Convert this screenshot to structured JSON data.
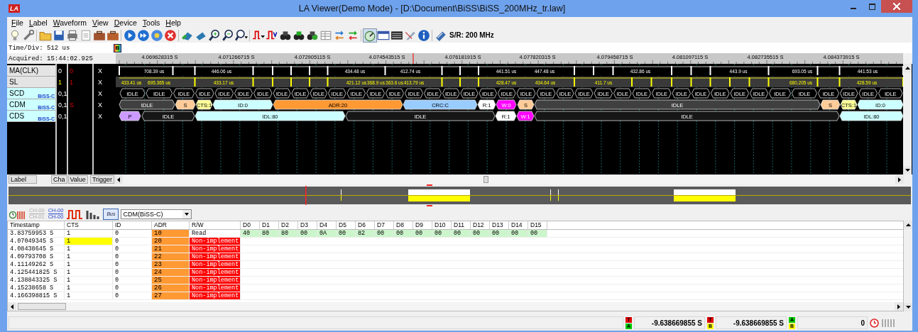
{
  "window": {
    "app_icon": "LA",
    "title": "LA Viewer(Demo Mode) - [D:\\Document\\BiSS\\BiSS_200MHz_tr.law]"
  },
  "menu": [
    {
      "label": "File"
    },
    {
      "label": "Label"
    },
    {
      "label": "Waveform"
    },
    {
      "label": "View"
    },
    {
      "label": "Device"
    },
    {
      "label": "Tools"
    },
    {
      "label": "Help"
    }
  ],
  "toolbar": {
    "sample_rate": "S/R: 200 MHz"
  },
  "waveform": {
    "time_div": "Time/Div: 512 us",
    "acquired": "Acquired: 15:44:02.925",
    "marker": "B",
    "time_labels": [
      "4.069628315 S",
      "4.071266715 S",
      "4.072905115 S",
      "4.074543515 S",
      "4.076181915 S",
      "4.077820315 S",
      "4.079458715 S",
      "4.081097115 S",
      "4.082735515 S",
      "4.084373915 S"
    ],
    "channels": [
      {
        "label": "MA(CLK)",
        "kind": "clock",
        "ch": "0",
        "value": "0",
        "trigger": "X",
        "pulse_labels": [
          "708.39 us",
          "446.06 us",
          "434.48 us",
          "412.74 us",
          "441.51 us",
          "447.48 us",
          "432.86 us",
          "443.9 us",
          "693.05 us",
          "441.53 us"
        ]
      },
      {
        "label": "SL",
        "kind": "data",
        "ch": "1",
        "value": "1",
        "trigger": "X",
        "pulse_labels": [
          "433.41 us",
          "695.365 us",
          "433.17 us",
          "421.12 us",
          "368.9 us",
          "363.6 us",
          "413.79 us",
          "428.47 us",
          "434.64 us",
          "411.7 us",
          "680.205 us",
          "428.59 us"
        ]
      },
      {
        "label": "SCD",
        "kind": "bus",
        "protocol": "BiSS-C",
        "ch": "0,1",
        "trigger": "X",
        "segments": [
          {
            "text": "IDLE",
            "color": "#000000"
          },
          {
            "text": "IDLE",
            "color": "#000000"
          },
          {
            "text": "IDLE",
            "color": "#000000"
          },
          {
            "text": "IDLE",
            "color": "#000000"
          },
          {
            "text": "IDLE",
            "color": "#000000"
          },
          {
            "text": "IDLE",
            "color": "#000000"
          },
          {
            "text": "IDLE",
            "color": "#000000"
          },
          {
            "text": "IDLE",
            "color": "#000000"
          },
          {
            "text": "IDLE",
            "color": "#000000"
          },
          {
            "text": "IDLE",
            "color": "#000000"
          },
          {
            "text": "IDLE",
            "color": "#000000"
          },
          {
            "text": "IDLE",
            "color": "#000000"
          },
          {
            "text": "IDLE",
            "color": "#000000"
          },
          {
            "text": "IDLE",
            "color": "#000000"
          },
          {
            "text": "IDLE",
            "color": "#000000"
          },
          {
            "text": "IDLE",
            "color": "#000000"
          },
          {
            "text": "IDLE",
            "color": "#000000"
          },
          {
            "text": "IDLE",
            "color": "#000000"
          },
          {
            "text": "IDLE",
            "color": "#000000"
          },
          {
            "text": "IDLE",
            "color": "#000000"
          },
          {
            "text": "IDLE",
            "color": "#000000"
          },
          {
            "text": "IDLE",
            "color": "#000000"
          },
          {
            "text": "IDLE",
            "color": "#000000"
          },
          {
            "text": "IDLE",
            "color": "#000000"
          },
          {
            "text": "IDLE",
            "color": "#000000"
          },
          {
            "text": "IDLE",
            "color": "#000000"
          },
          {
            "text": "IDLE",
            "color": "#000000"
          },
          {
            "text": "IDLE",
            "color": "#000000"
          },
          {
            "text": "IDLE",
            "color": "#000000"
          },
          {
            "text": "IDLE",
            "color": "#000000"
          },
          {
            "text": "IDLE",
            "color": "#000000"
          },
          {
            "text": "IDLE",
            "color": "#000000"
          },
          {
            "text": "IDLE",
            "color": "#000000"
          },
          {
            "text": "IDLE",
            "color": "#000000"
          },
          {
            "text": "IDLE",
            "color": "#000000"
          },
          {
            "text": "IDLE",
            "color": "#000000"
          },
          {
            "text": "IDLE",
            "color": "#000000"
          },
          {
            "text": "IDLE",
            "color": "#000000"
          },
          {
            "text": "IDLE",
            "color": "#000000"
          }
        ]
      },
      {
        "label": "CDM",
        "kind": "bus",
        "protocol": "BiSS-C",
        "ch": "0,1",
        "value": "S",
        "trigger": "X",
        "segments": [
          {
            "text": "IDLE",
            "color": "#404040"
          },
          {
            "text": "S",
            "color": "#ffcc99"
          },
          {
            "text": "CTS:1",
            "color": "#ffff99"
          },
          {
            "text": "ID:0",
            "color": "#ccffff"
          },
          {
            "text": "ADR:20",
            "color": "#ff9933"
          },
          {
            "text": "CRC:C",
            "color": "#99ccff"
          },
          {
            "text": "R:1",
            "color": "#ffffff"
          },
          {
            "text": "W:0",
            "color": "#ff00ff"
          },
          {
            "text": "S",
            "color": "#ffcc99"
          },
          {
            "text": "IDLE",
            "color": "#404040"
          },
          {
            "text": "S",
            "color": "#ffcc99"
          },
          {
            "text": "CTS:1",
            "color": "#ffff99"
          },
          {
            "text": "ID:0",
            "color": "#ccffff"
          }
        ]
      },
      {
        "label": "CDS",
        "kind": "bus",
        "protocol": "BiSS-C",
        "ch": "0,1",
        "trigger": "X",
        "segments": [
          {
            "text": "P",
            "color": "#cc99ff"
          },
          {
            "text": "IDLE",
            "color": "#161616"
          },
          {
            "text": "IDL:80",
            "color": "#ccffff"
          },
          {
            "text": "IDLE",
            "color": "#161616"
          },
          {
            "text": "R:1",
            "color": "#ffffff"
          },
          {
            "text": "W:1",
            "color": "#ff00ff"
          },
          {
            "text": "IDLE",
            "color": "#161616"
          },
          {
            "text": "IDL:80",
            "color": "#ccffff"
          }
        ]
      }
    ]
  },
  "column_headers": [
    "Label",
    "Cha",
    "Value",
    "Trigger"
  ],
  "decoder": {
    "channel_buttons": [
      {
        "lines": [
          "CH-00",
          "CH-01"
        ],
        "disabled": true
      },
      {
        "lines": [
          "CH-00",
          "CH-00"
        ],
        "disabled": false
      }
    ],
    "bus_button": {
      "label": "Bus",
      "selected": true
    },
    "decoder_select": "CDM(BiSS-C)"
  },
  "table": {
    "columns": [
      "Timestamp",
      "CTS",
      "ID",
      "ADR",
      "R/W",
      "D0",
      "D1",
      "D2",
      "D3",
      "D4",
      "D5",
      "D6",
      "D7",
      "D8",
      "D9",
      "D10",
      "D11",
      "D12",
      "D13",
      "D14",
      "D15"
    ],
    "rows": [
      {
        "timestamp": "3.83759953 S",
        "cts": "1",
        "cts_highlighted": false,
        "id": "0",
        "adr": "10",
        "rw": "Read",
        "rw_error": false,
        "data": [
          "40",
          "80",
          "80",
          "00",
          "0A",
          "00",
          "82",
          "00",
          "00",
          "00",
          "00",
          "00",
          "00",
          "00",
          "00",
          "00"
        ]
      },
      {
        "timestamp": "4.07049345 S",
        "cts": "1",
        "cts_highlighted": true,
        "id": "0",
        "adr": "20",
        "rw": "Non-implement",
        "rw_error": true
      },
      {
        "timestamp": "4.08438645 S",
        "cts": "1",
        "cts_highlighted": false,
        "id": "0",
        "adr": "21",
        "rw": "Non-implement",
        "rw_error": true
      },
      {
        "timestamp": "4.09793708 S",
        "cts": "1",
        "cts_highlighted": false,
        "id": "0",
        "adr": "22",
        "rw": "Non-implement",
        "rw_error": true
      },
      {
        "timestamp": "4.11149262 S",
        "cts": "1",
        "cts_highlighted": false,
        "id": "0",
        "adr": "23",
        "rw": "Non-implement",
        "rw_error": true
      },
      {
        "timestamp": "4.125441825 S",
        "cts": "1",
        "cts_highlighted": false,
        "id": "0",
        "adr": "24",
        "rw": "Non-implement",
        "rw_error": true
      },
      {
        "timestamp": "4.138843325 S",
        "cts": "1",
        "cts_highlighted": false,
        "id": "0",
        "adr": "25",
        "rw": "Non-implement",
        "rw_error": true
      },
      {
        "timestamp": "4.15238658 S",
        "cts": "1",
        "cts_highlighted": false,
        "id": "0",
        "adr": "26",
        "rw": "Non-implement",
        "rw_error": true
      },
      {
        "timestamp": "4.166398815 S",
        "cts": "1",
        "cts_highlighted": false,
        "id": "0",
        "adr": "27",
        "rw": "Non-implement",
        "rw_error": true
      }
    ]
  },
  "status_bar": {
    "cursors": [
      {
        "badges": [
          {
            "text": "T",
            "color": "#e00000"
          },
          {
            "text": "A",
            "color": "#00cc00"
          }
        ],
        "value": "-9.638669855 S"
      },
      {
        "badges": [
          {
            "text": "T",
            "color": "#e00000"
          },
          {
            "text": "B",
            "color": "#ffff00"
          }
        ],
        "value": "-9.638669855 S"
      },
      {
        "badges": [
          {
            "text": "A",
            "color": "#00cc00"
          },
          {
            "text": "B",
            "color": "#ffff00"
          }
        ],
        "value": "0"
      }
    ]
  }
}
